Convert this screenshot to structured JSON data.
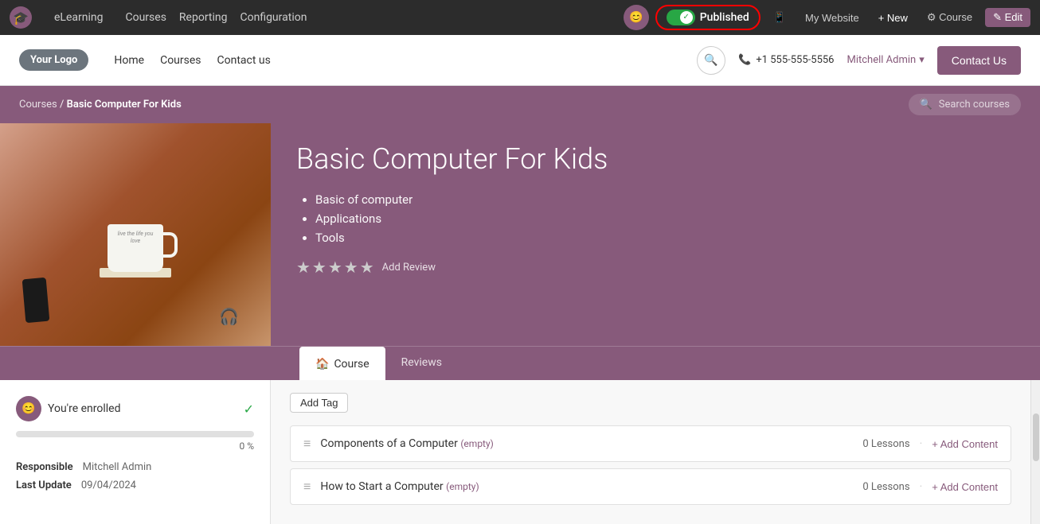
{
  "adminBar": {
    "logoIcon": "🎓",
    "appName": "eLearning",
    "navItems": [
      "Courses",
      "Reporting",
      "Configuration"
    ],
    "publishedLabel": "Published",
    "myWebsite": "My Website",
    "newLabel": "+ New",
    "courseLabel": "⚙ Course",
    "editLabel": "✎ Edit"
  },
  "websiteHeader": {
    "logoText": "Your Logo",
    "navItems": [
      "Home",
      "Courses",
      "Contact us"
    ],
    "phone": "+1 555-555-5556",
    "user": "Mitchell Admin",
    "contactUs": "Contact Us"
  },
  "breadcrumb": {
    "parent": "Courses",
    "current": "Basic Computer For Kids",
    "searchPlaceholder": "Search courses"
  },
  "course": {
    "title": "Basic Computer For Kids",
    "bullets": [
      "Basic of computer",
      "Applications",
      "Tools",
      ""
    ],
    "addReview": "Add Review",
    "tabs": [
      "Course",
      "Reviews"
    ]
  },
  "sidebar": {
    "enrolledText": "You're enrolled",
    "progressPercent": "0 %",
    "responsibleLabel": "Responsible",
    "responsibleValue": "Mitchell Admin",
    "lastUpdateLabel": "Last Update",
    "lastUpdateValue": "09/04/2024"
  },
  "courseContent": {
    "addTagLabel": "Add Tag",
    "rows": [
      {
        "title": "Components of a Computer",
        "emptyLabel": "(empty)",
        "lessons": "0 Lessons",
        "addContent": "+ Add Content"
      },
      {
        "title": "How to Start a Computer",
        "emptyLabel": "(empty)",
        "lessons": "0 Lessons",
        "addContent": "+ Add Content"
      }
    ]
  },
  "colors": {
    "brand": "#875a7b",
    "green": "#28a745",
    "dark": "#2c2c2c"
  }
}
